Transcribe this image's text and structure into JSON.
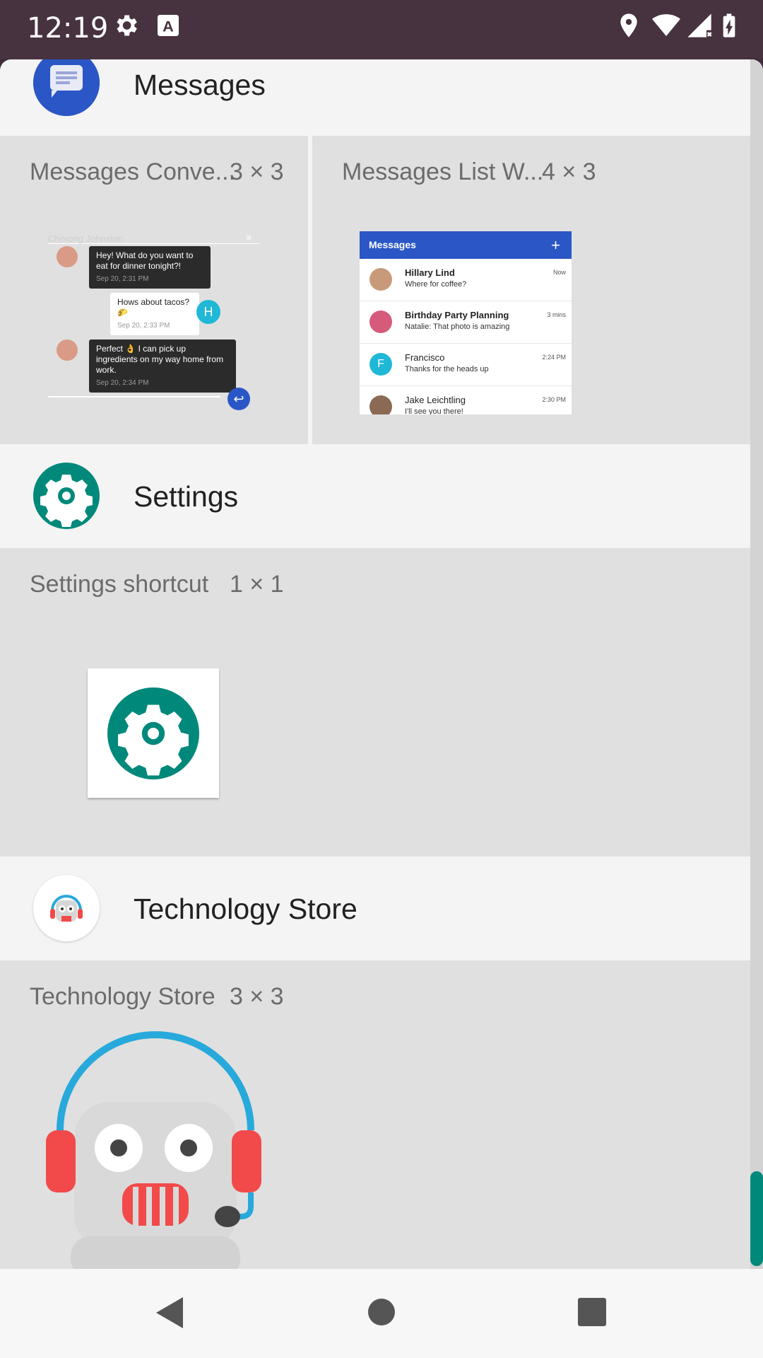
{
  "status_bar": {
    "time": "12:19",
    "icons": [
      "gear-icon",
      "a-font-icon",
      "location-icon",
      "wifi-icon",
      "signal-icon",
      "battery-charging-icon"
    ]
  },
  "sections": [
    {
      "app_name": "Messages",
      "icon": "messages-app-icon",
      "widgets": [
        {
          "name": "Messages Conve...",
          "size": "3 × 3",
          "preview": {
            "contact": "Chorong Johnston",
            "messages": [
              {
                "text": "Hey! What do you want to eat for dinner tonight?!",
                "time": "Sep 20, 2:31 PM"
              },
              {
                "text": "Hows about tacos? 🌮",
                "time": "Sep 20, 2:33 PM",
                "avatar_letter": "H"
              },
              {
                "text": "Perfect 👌 I can pick up ingredients on my way home from work.",
                "time": "Sep 20, 2:34 PM"
              }
            ]
          }
        },
        {
          "name": "Messages List W...",
          "size": "4 × 3",
          "preview": {
            "title": "Messages",
            "add_label": "+",
            "rows": [
              {
                "name": "Hillary Lind",
                "message": "Where for coffee?",
                "time": "Now",
                "avatar_color": "#c99a7a"
              },
              {
                "name": "Birthday Party Planning",
                "message": "Natalie: That photo is amazing",
                "time": "3 mins",
                "avatar_color": "#d65a7b"
              },
              {
                "name": "Francisco",
                "message": "Thanks for the heads up",
                "time": "2:24 PM",
                "avatar_color": "#1fb8d6",
                "avatar_letter": "F"
              },
              {
                "name": "Jake Leichtling",
                "message": "I'll see you there!",
                "time": "2:30 PM",
                "avatar_color": "#8a6a55"
              }
            ]
          }
        }
      ]
    },
    {
      "app_name": "Settings",
      "icon": "settings-app-icon",
      "widgets": [
        {
          "name": "Settings shortcut",
          "size": "1 × 1"
        }
      ]
    },
    {
      "app_name": "Technology Store",
      "icon": "technology-store-app-icon",
      "widgets": [
        {
          "name": "Technology Store",
          "size": "3 × 3"
        }
      ]
    }
  ],
  "nav_bar": {
    "buttons": [
      "back-icon",
      "home-icon",
      "recents-icon"
    ]
  },
  "colors": {
    "status_bar": "#47323f",
    "settings_teal": "#00897b",
    "messages_blue": "#2b57c6",
    "scroll_thumb": "#00897b"
  }
}
